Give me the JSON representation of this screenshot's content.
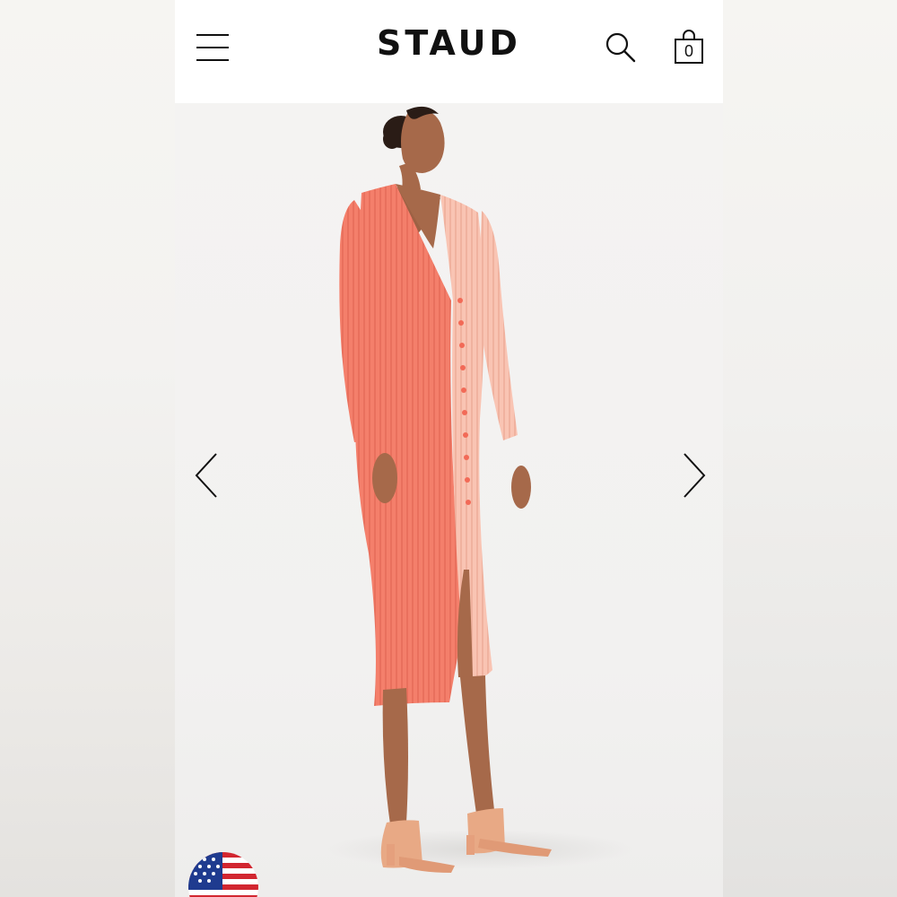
{
  "header": {
    "brand": "STAUD",
    "cart_count": "0"
  },
  "icons": {
    "menu": "hamburger-menu-icon",
    "search": "search-icon",
    "cart": "shopping-bag-icon",
    "prev": "chevron-left-icon",
    "next": "chevron-right-icon",
    "flag": "us-flag-icon"
  },
  "product": {
    "colors": {
      "coral": "#f47f6b",
      "blush": "#f9c4b3",
      "sandal": "#e8a985"
    }
  }
}
